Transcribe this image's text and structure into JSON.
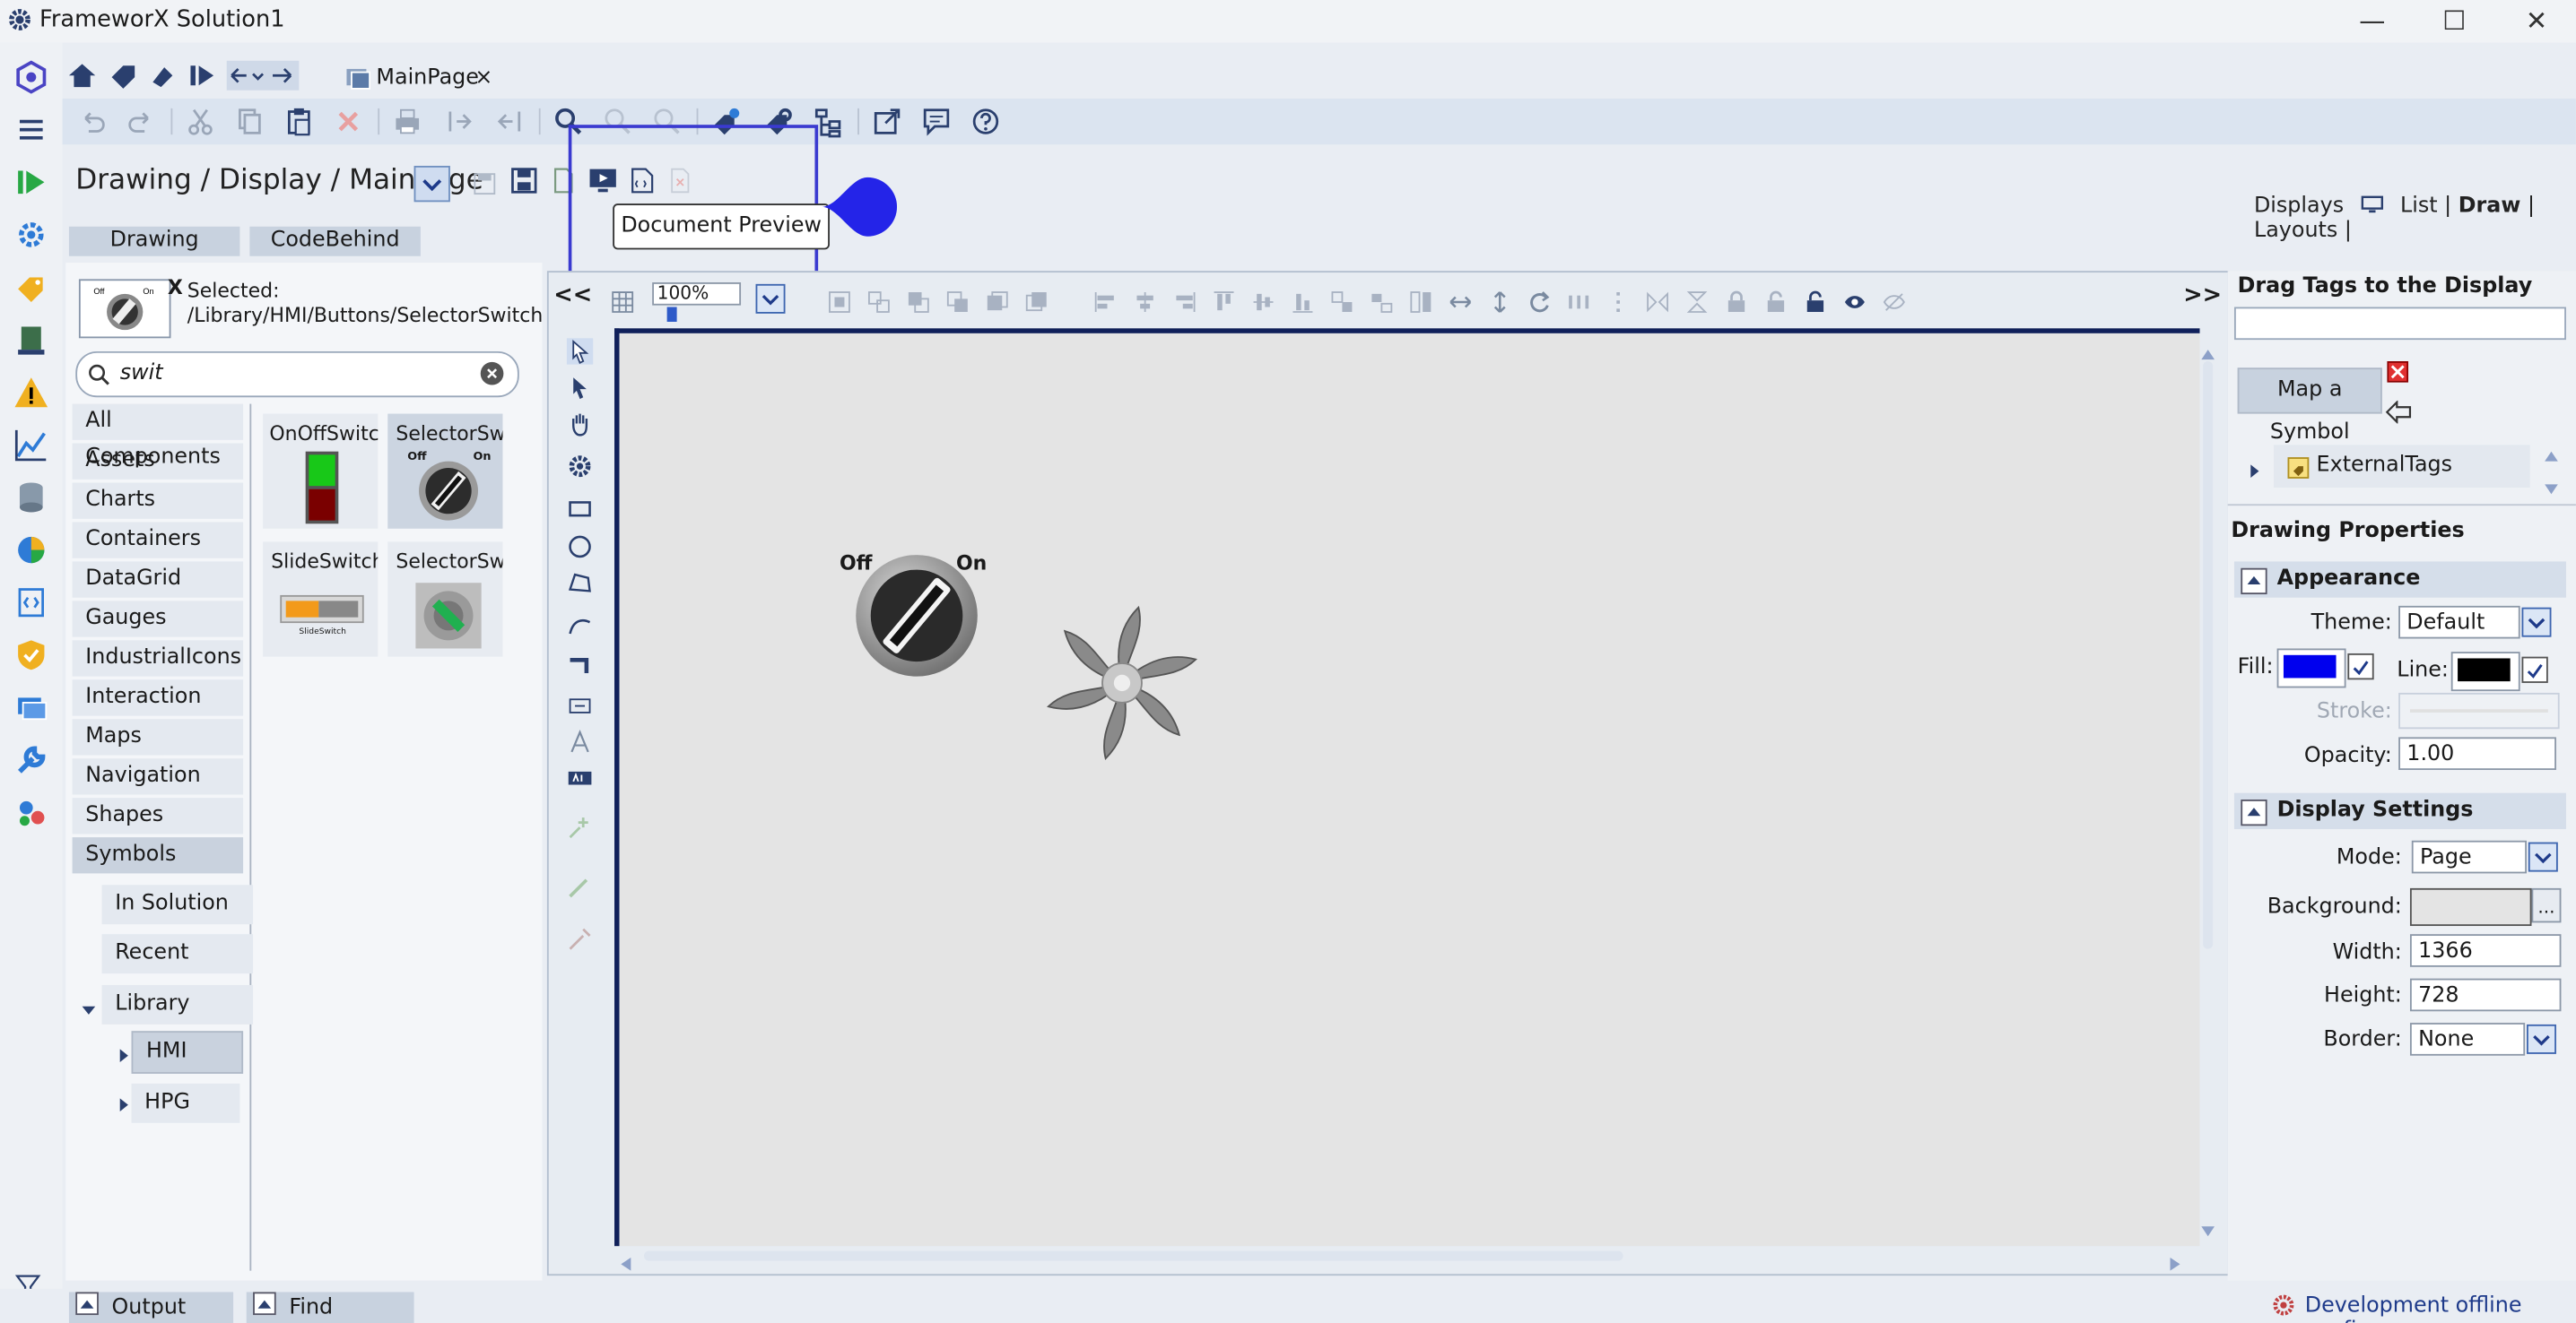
{
  "app": {
    "title": "FrameworX Solution1"
  },
  "window": {
    "minimize": "—",
    "maximize": "☐",
    "close": "✕"
  },
  "doc_tab": {
    "label": "MainPage",
    "close": "×"
  },
  "breadcrumb": "Drawing / Display / MainPage",
  "tooltip": "Document Preview",
  "displays_nav": {
    "label": "Displays",
    "list": "List",
    "draw": "Draw",
    "layouts": "Layouts",
    "sep": "|"
  },
  "tabs": {
    "drawing": "Drawing",
    "codebehind": "CodeBehind"
  },
  "selected": {
    "x": "X",
    "label": "Selected:",
    "path": "/Library/HMI/Buttons/SelectorSwitch"
  },
  "search": {
    "value": "swit"
  },
  "categories": [
    "All Components",
    "Assets",
    "Charts",
    "Containers",
    "DataGrid",
    "Gauges",
    "IndustrialIcons",
    "Interaction",
    "Maps",
    "Navigation",
    "Shapes",
    "Symbols"
  ],
  "symbols_sub": {
    "in_solution": "In Solution",
    "recent": "Recent",
    "library": "Library",
    "hmi": "HMI",
    "hpg": "HPG"
  },
  "thumbs": [
    {
      "label": "OnOffSwitc"
    },
    {
      "label": "SelectorSw",
      "off": "Off",
      "on": "On"
    },
    {
      "label": "SlideSwitch",
      "sub": "SlideSwitch"
    },
    {
      "label": "SelectorSw"
    }
  ],
  "canvas": {
    "collapse": "<<",
    "expand": ">>",
    "zoom": "100%",
    "switch_off": "Off",
    "switch_on": "On"
  },
  "right": {
    "drag_title": "Drag Tags to the Display",
    "map_symbol": "Map a Symbol",
    "external_tags": "ExternalTags",
    "drawing_props": "Drawing Properties",
    "appearance": "Appearance",
    "theme_label": "Theme:",
    "theme": "Default",
    "fill_label": "Fill:",
    "line_label": "Line:",
    "stroke_label": "Stroke:",
    "opacity_label": "Opacity:",
    "opacity": "1.00",
    "display_settings": "Display Settings",
    "mode_label": "Mode:",
    "mode": "Page",
    "background_label": "Background:",
    "bg_more": "...",
    "width_label": "Width:",
    "width": "1366",
    "height_label": "Height:",
    "height": "728",
    "border_label": "Border:",
    "border": "None"
  },
  "colors": {
    "accent": "#3a3ad0",
    "fill": "#0000ee",
    "line": "#000000"
  },
  "status": {
    "output": "Output",
    "find_results": "Find Results",
    "dev": "Development offline config"
  }
}
